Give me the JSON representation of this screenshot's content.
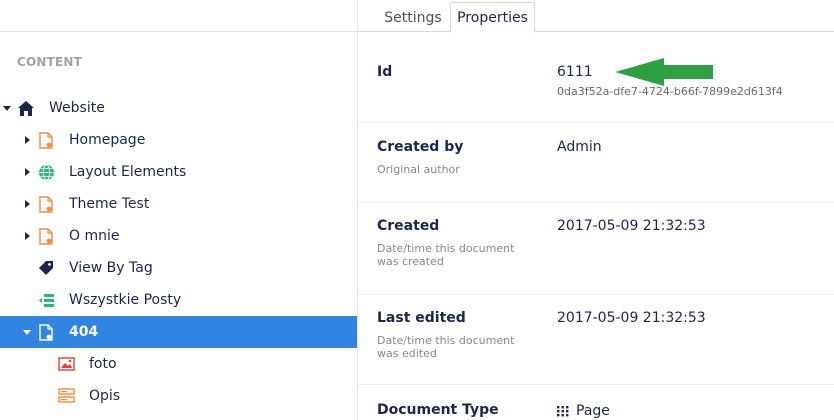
{
  "tree": {
    "heading": "CONTENT",
    "items": [
      {
        "label": "Website",
        "icon": "home-icon"
      },
      {
        "label": "Homepage",
        "icon": "document-icon"
      },
      {
        "label": "Layout Elements",
        "icon": "globe-icon"
      },
      {
        "label": "Theme Test",
        "icon": "document-icon"
      },
      {
        "label": "O mnie",
        "icon": "document-icon"
      },
      {
        "label": "View By Tag",
        "icon": "tag-icon"
      },
      {
        "label": "Wszystkie Posty",
        "icon": "list-icon"
      },
      {
        "label": "404",
        "icon": "document-icon"
      },
      {
        "label": "foto",
        "icon": "image-icon"
      },
      {
        "label": "Opis",
        "icon": "block-icon"
      }
    ]
  },
  "tabs": {
    "settings": "Settings",
    "properties": "Properties"
  },
  "properties": {
    "id": {
      "title": "Id",
      "value": "6111",
      "guid": "0da3f52a-dfe7-4724-b66f-7899e2d613f4"
    },
    "created_by": {
      "title": "Created by",
      "desc": "Original author",
      "value": "Admin"
    },
    "created": {
      "title": "Created",
      "desc": "Date/time this document was created",
      "value": "2017-05-09 21:32:53"
    },
    "last_edited": {
      "title": "Last edited",
      "desc": "Date/time this document was edited",
      "value": "2017-05-09 21:32:53"
    },
    "document_type": {
      "title": "Document Type",
      "value": "Page"
    }
  },
  "colors": {
    "selected": "#3185e1",
    "document_icon": "#f08a3c",
    "globe_icon": "#2bb673",
    "list_icon": "#2bb673",
    "image_icon": "#e03c31",
    "arrow": "#2ea043"
  }
}
